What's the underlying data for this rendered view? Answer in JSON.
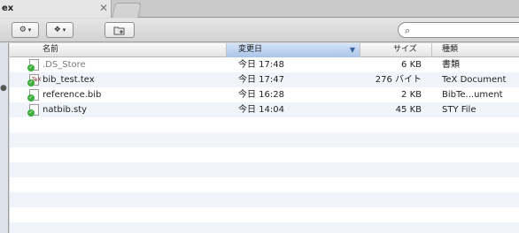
{
  "tabs": [
    {
      "title": "ex",
      "active": true
    },
    {
      "title": "",
      "active": false
    }
  ],
  "toolbar": {
    "action_icon": "gear-icon",
    "dropbox_icon": "dropbox-icon",
    "new_folder_icon": "new-folder-icon",
    "search_placeholder": ""
  },
  "columns": [
    {
      "label": "名前"
    },
    {
      "label": "変更日",
      "sorted": true
    },
    {
      "label": "サイズ"
    },
    {
      "label": "種類"
    }
  ],
  "files": [
    {
      "name": ".DS_Store",
      "date": "今日 17:48",
      "size": "6 KB",
      "kind": "書類",
      "hidden": true
    },
    {
      "name": "bib_test.tex",
      "date": "今日 17:47",
      "size": "276 バイト",
      "kind": "TeX Document",
      "hidden": false
    },
    {
      "name": "reference.bib",
      "date": "今日 16:28",
      "size": "2 KB",
      "kind": "BibTe...ument",
      "hidden": false
    },
    {
      "name": "natbib.sty",
      "date": "今日 14:04",
      "size": "45 KB",
      "kind": "STY File",
      "hidden": false
    }
  ],
  "colors": {
    "selection_header": "#aac4e8",
    "row_stripe": "#f0f4fa",
    "sync_badge": "#3bae3b"
  }
}
